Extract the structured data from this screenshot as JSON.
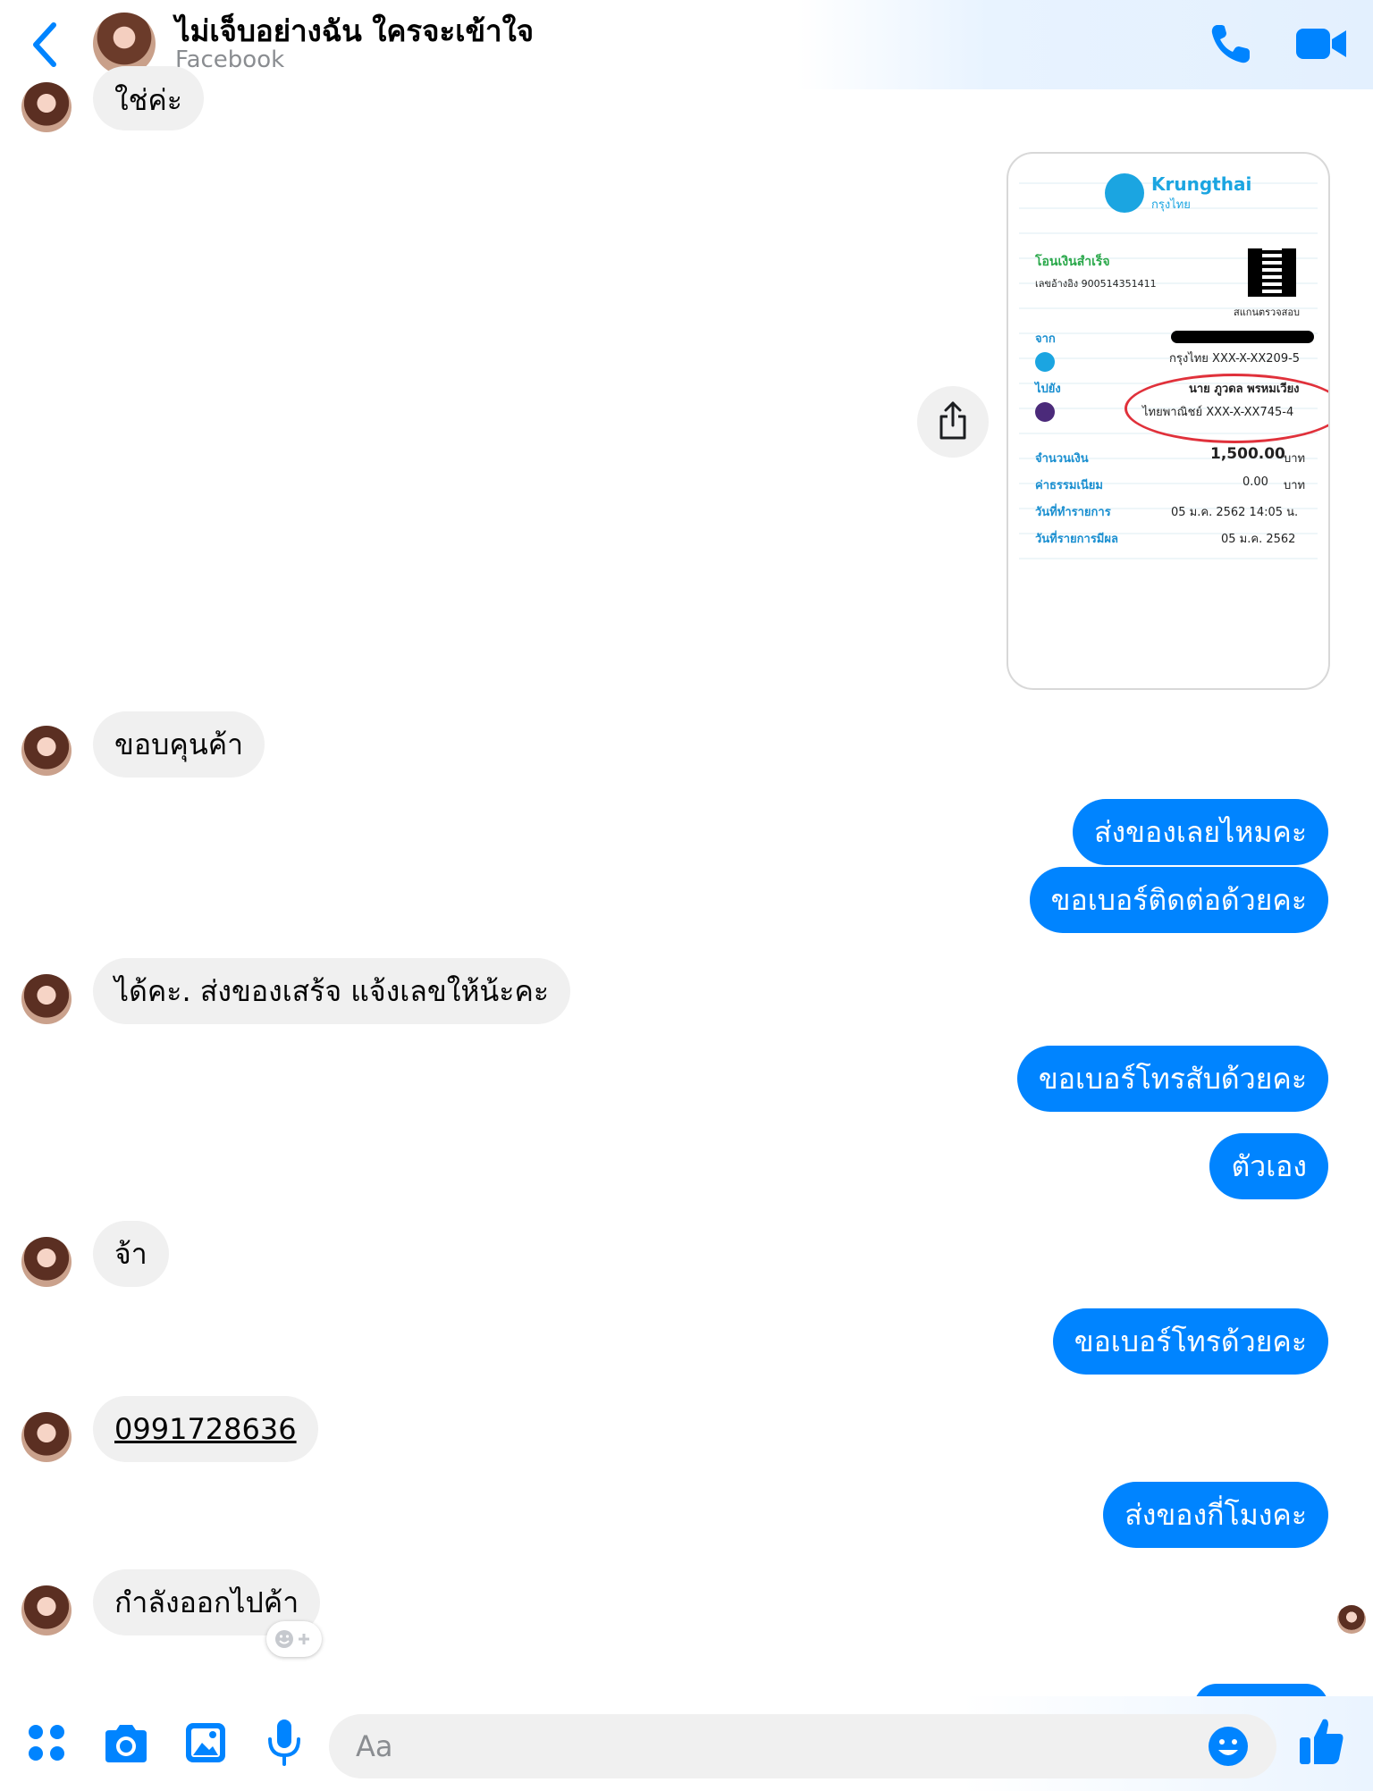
{
  "header": {
    "title": "ไม่เจ็บอย่างฉัน ใครจะเข้าใจ",
    "subtitle": "Facebook"
  },
  "messages": {
    "m1": "ใช่ค่ะ",
    "m2": "ขอบคุนค้า",
    "m3": "ส่งของเลยไหมคะ",
    "m4": "ขอเบอร์ติดต่อด้วยคะ",
    "m5": "ได้คะ. ส่งของเสร้จ แจ้งเลขให้น้ะคะ",
    "m6": "ขอเบอร์โทรสับด้วยคะ",
    "m7": "ตัวเอง",
    "m8": "จ้า",
    "m9": "ขอเบอร์โทรด้วยคะ",
    "m10": "0991728636",
    "m11": "ส่งของกี่โมงคะ",
    "m12": "กำลังออกไปค้า"
  },
  "receipt": {
    "brand": "Krungthai",
    "brand_th": "กรุงไทย",
    "status": "โอนเงินสำเร็จ",
    "ref": "เลขอ้างอิง 900514351411",
    "scan": "สแกนตรวจสอบ",
    "from_label": "จาก",
    "from_account": "กรุงไทย XXX-X-XX209-5",
    "to_label": "ไปยัง",
    "to_name": "นาย ภูวดล พรหมเวียง",
    "to_account": "ไทยพาณิชย์ XXX-X-XX745-4",
    "amount_label": "จำนวนเงิน",
    "amount": "1,500.00",
    "currency": "บาท",
    "fee_label": "ค่าธรรมเนียม",
    "fee": "0.00",
    "date_label": "วันที่ทำรายการ",
    "date": "05 ม.ค. 2562 14:05 น.",
    "effective_label": "วันที่รายการมีผล",
    "effective": "05 ม.ค. 2562"
  },
  "composer": {
    "placeholder": "Aa"
  },
  "icons": {
    "back": "chevron-left-icon",
    "phone": "phone-icon",
    "video": "video-icon",
    "menu": "four-dots-icon",
    "camera": "camera-icon",
    "gallery": "image-icon",
    "mic": "microphone-icon",
    "emoji": "emoji-icon",
    "like": "thumbs-up-icon",
    "share": "share-icon"
  },
  "colors": {
    "accent": "#0084ff",
    "incoming_bubble": "#f0f0f0"
  }
}
